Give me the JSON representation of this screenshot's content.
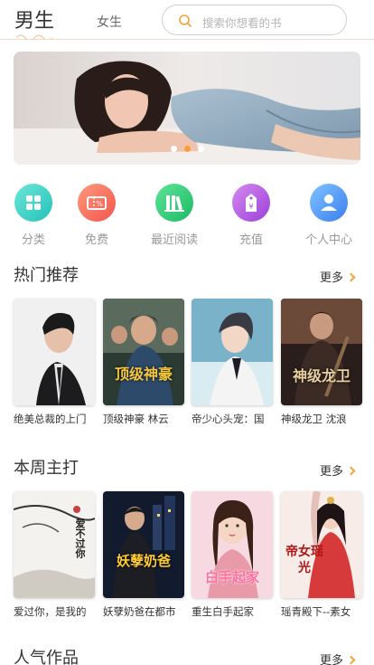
{
  "header": {
    "active_tab": "男生",
    "inactive_tab": "女生",
    "search_placeholder": "搜索你想看的书"
  },
  "banner": {
    "dots": 3,
    "active_dot": 1
  },
  "quicknav": [
    {
      "label": "分类",
      "icon": "category-icon",
      "color": "#3fd7c6"
    },
    {
      "label": "免费",
      "icon": "ticket-icon",
      "color": "#f86a5c"
    },
    {
      "label": "最近阅读",
      "icon": "books-icon",
      "color": "#2ecf7a"
    },
    {
      "label": "充值",
      "icon": "price-tag-icon",
      "color": "#b04ee0"
    },
    {
      "label": "个人中心",
      "icon": "user-icon",
      "color": "#4a8ef5"
    }
  ],
  "sections": [
    {
      "title": "热门推荐",
      "more": "更多",
      "books": [
        {
          "title": "绝美总裁的上门",
          "cover_text": ""
        },
        {
          "title": "顶级神豪 林云",
          "cover_text": "顶级神豪"
        },
        {
          "title": "帝少心头宠：国",
          "cover_text": ""
        },
        {
          "title": "神级龙卫 沈浪",
          "cover_text": "神级龙卫"
        }
      ]
    },
    {
      "title": "本周主打",
      "more": "更多",
      "books": [
        {
          "title": "爱过你，是我的",
          "cover_text": "爱不过你"
        },
        {
          "title": "妖孽奶爸在都市",
          "cover_text": "妖孽奶爸"
        },
        {
          "title": "重生白手起家",
          "cover_text": "白手起家"
        },
        {
          "title": "瑶青殿下--素女",
          "cover_text": "帝女瑶光"
        }
      ]
    },
    {
      "title": "人气作品",
      "more": "更多"
    }
  ]
}
